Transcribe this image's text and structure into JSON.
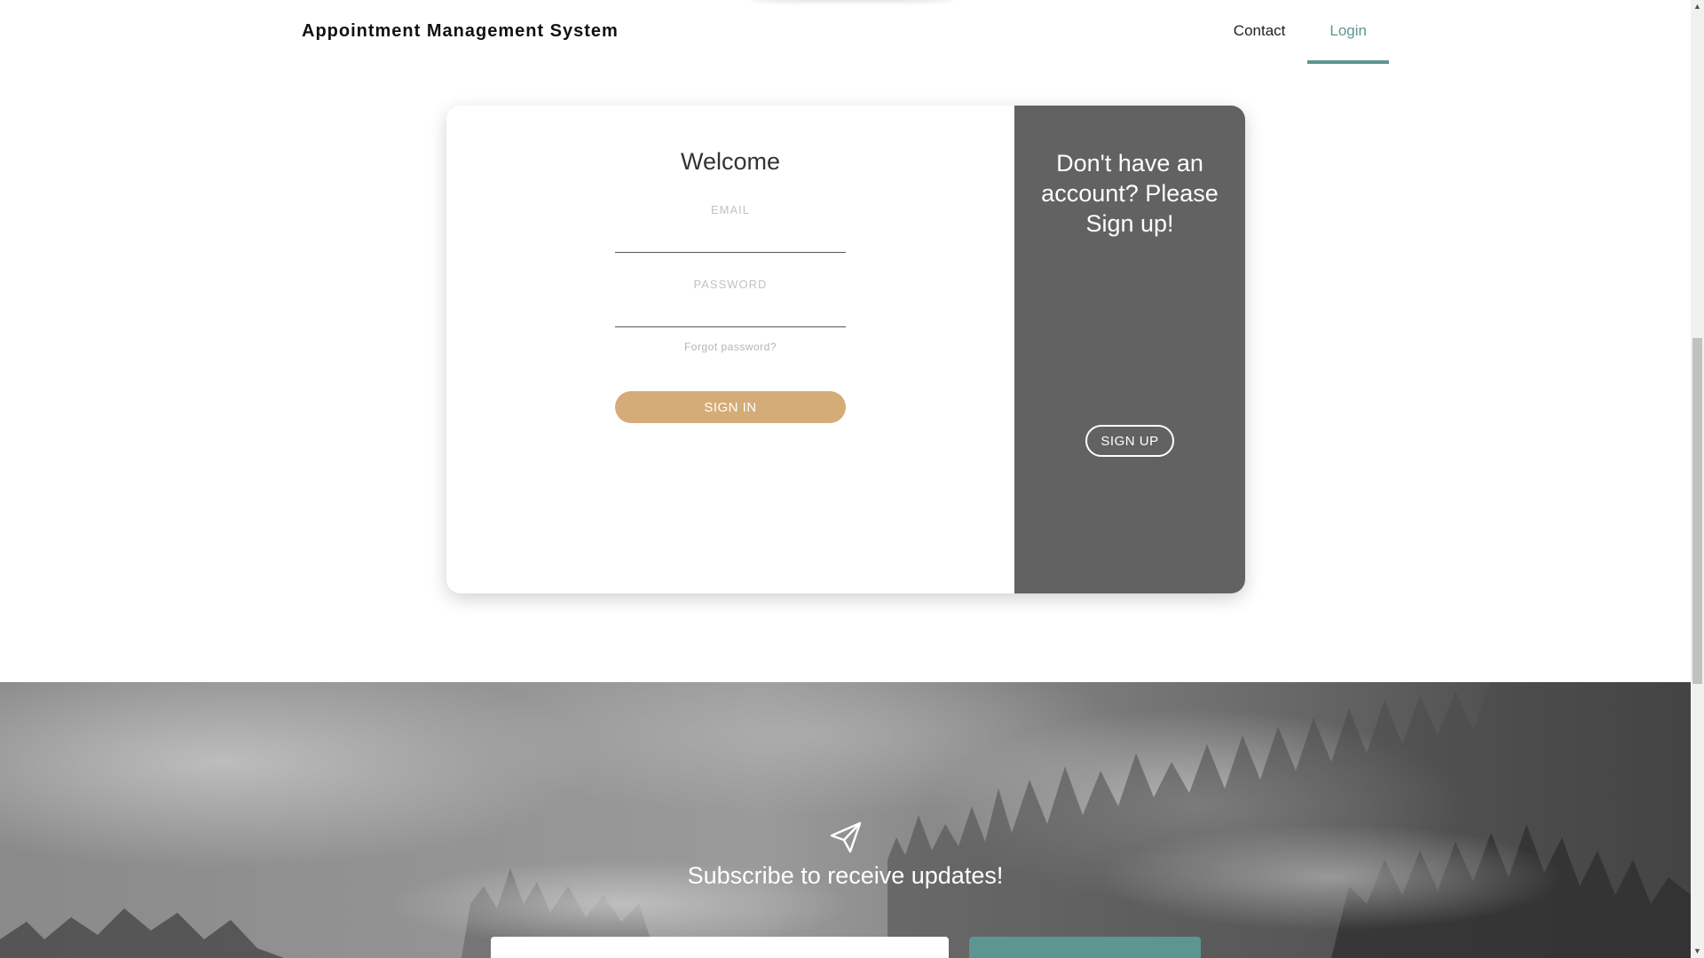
{
  "header": {
    "brand": "Appointment Management System",
    "nav": [
      {
        "label": "Contact",
        "active": false
      },
      {
        "label": "Login",
        "active": true
      }
    ]
  },
  "login": {
    "title": "Welcome",
    "email_label": "EMAIL",
    "email_value": "",
    "password_label": "PASSWORD",
    "password_value": "",
    "forgot_label": "Forgot password?",
    "signin_label": "SIGN IN"
  },
  "signup": {
    "text": "Don't have an account? Please Sign up!",
    "button_label": "SIGN UP"
  },
  "subscribe": {
    "title": "Subscribe to receive updates!",
    "email_value": "",
    "icon": "paper-plane-icon"
  },
  "colors": {
    "accent": "#5d9592",
    "signin_button": "#d4ac78",
    "signup_panel": "#626262"
  },
  "scrollbar": {
    "up_icon": "▲",
    "down_icon": "▼"
  }
}
